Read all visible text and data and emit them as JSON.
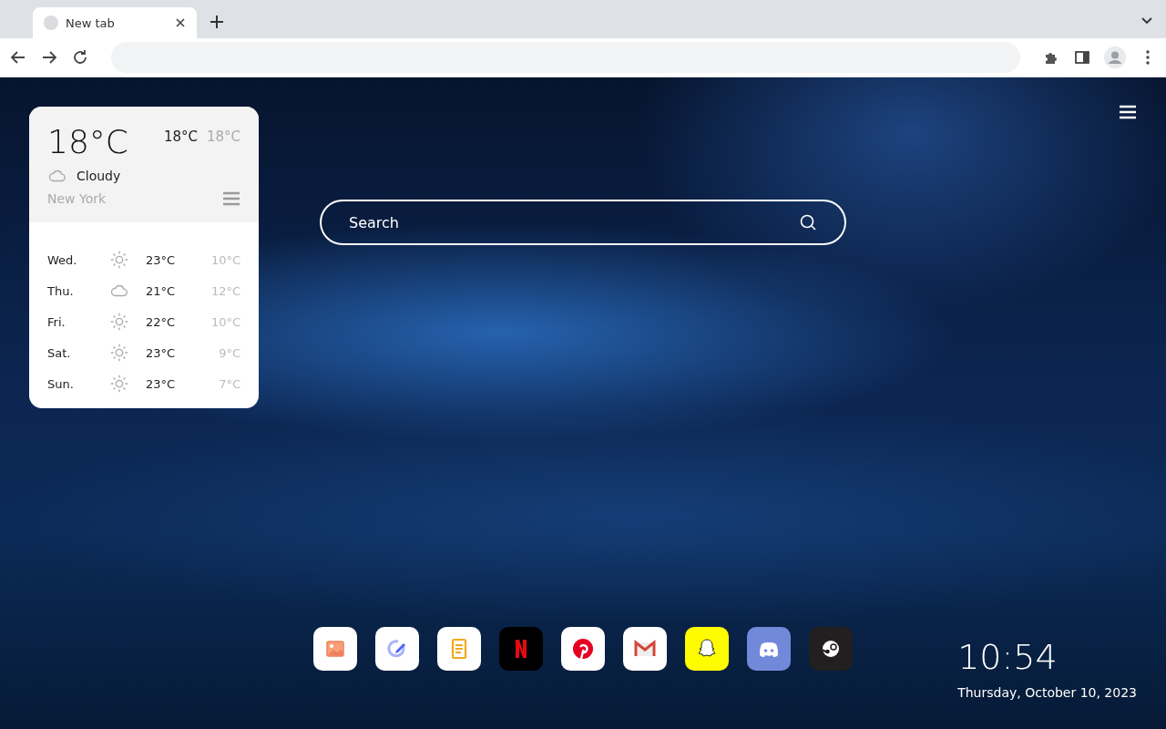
{
  "browser": {
    "tab": {
      "title": "New tab",
      "selected": true
    }
  },
  "weather": {
    "temperature": "18°C",
    "high": "18°C",
    "low": "18°C",
    "condition": {
      "kind": "cloudy",
      "label": "Cloudy"
    },
    "city": "New York",
    "forecast": [
      {
        "day": "Wed.",
        "kind": "sunny",
        "high": "23°C",
        "low": "10°C"
      },
      {
        "day": "Thu.",
        "kind": "cloudy",
        "high": "21°C",
        "low": "12°C"
      },
      {
        "day": "Fri.",
        "kind": "sunny",
        "high": "22°C",
        "low": "10°C"
      },
      {
        "day": "Sat.",
        "kind": "sunny",
        "high": "23°C",
        "low": "9°C"
      },
      {
        "day": "Sun.",
        "kind": "sunny",
        "high": "23°C",
        "low": "7°C"
      }
    ]
  },
  "search": {
    "placeholder": "Search"
  },
  "dock": [
    {
      "kind": "photos"
    },
    {
      "kind": "edit"
    },
    {
      "kind": "notes"
    },
    {
      "kind": "netflix"
    },
    {
      "kind": "pinterest"
    },
    {
      "kind": "gmail"
    },
    {
      "kind": "snapchat"
    },
    {
      "kind": "discord"
    },
    {
      "kind": "steam"
    }
  ],
  "clock": {
    "time": "10:54",
    "date": "Thursday, October 10, 2023"
  }
}
